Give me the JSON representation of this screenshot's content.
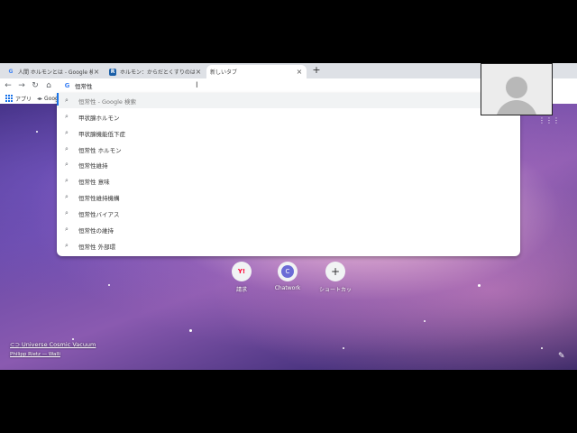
{
  "tabs": [
    {
      "favicon": "G",
      "title": "人間 ホルモンとは - Google 検索",
      "active": false
    },
    {
      "favicon": "R",
      "title": "ホルモン：からだとくすりのはなし：くす",
      "active": false
    },
    {
      "favicon": "",
      "title": "新しいタブ",
      "active": true
    }
  ],
  "new_tab_icon": "plus-icon",
  "omnibox": {
    "engine_badge": "G",
    "query": "恒常性"
  },
  "bookmarks": {
    "apps_label": "アプリ",
    "item_label": "Goog"
  },
  "suggestions": [
    "恒常性 - Google 検索",
    "甲状腺ホルモン",
    "甲状腺機能低下症",
    "恒常性 ホルモン",
    "恒常性維持",
    "恒常性 意味",
    "恒常性維持機構",
    "恒常性バイアス",
    "恒常性の維持",
    "恒常性 外部環"
  ],
  "shortcuts": [
    {
      "label": "請求",
      "icon_text": "Y!",
      "icon_color": "#ff0033"
    },
    {
      "label": "Chatwork",
      "icon_text": "C",
      "icon_color": "#6b6bd6"
    },
    {
      "label": "ショートカッ",
      "icon_text": "+",
      "icon_color": "#333333"
    }
  ],
  "attribution": {
    "title": "Universe Cosmic Vacuum",
    "author": "Philipp Rietz — Walli"
  }
}
